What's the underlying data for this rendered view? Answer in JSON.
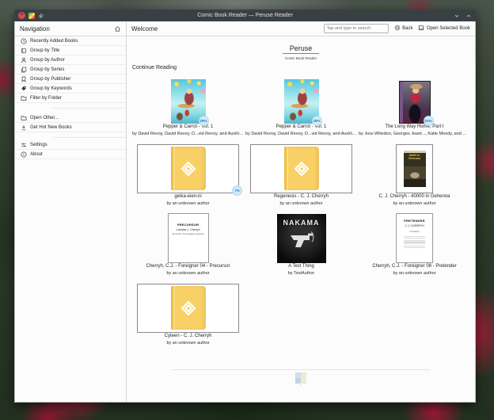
{
  "window": {
    "title": "Comic Book Reader — Peruse Reader"
  },
  "sidebar": {
    "title": "Navigation",
    "items": [
      {
        "label": "Recently Added Books",
        "icon": "clock-icon"
      },
      {
        "label": "Group by Title",
        "icon": "book-icon"
      },
      {
        "label": "Group by Author",
        "icon": "person-icon"
      },
      {
        "label": "Group by Series",
        "icon": "series-icon"
      },
      {
        "label": "Group by Publisher",
        "icon": "pennant-icon"
      },
      {
        "label": "Group by Keywords",
        "icon": "tag-icon"
      },
      {
        "label": "Filter by Folder",
        "icon": "folder-icon"
      }
    ],
    "secondary_items": [
      {
        "label": "Open Other...",
        "icon": "folder-icon"
      },
      {
        "label": "Get Hot New Books",
        "icon": "download-icon"
      }
    ],
    "footer_items": [
      {
        "label": "Settings",
        "icon": "settings-icon"
      },
      {
        "label": "About",
        "icon": "info-icon"
      }
    ]
  },
  "toolbar": {
    "page_title": "Welcome",
    "search_placeholder": "Tap and type to search",
    "back_label": "Back",
    "open_book_label": "Open Selected Book"
  },
  "hero": {
    "app_name": "Peruse",
    "app_subtitle": "Comic Book Reader"
  },
  "section": {
    "title": "Continue Reading"
  },
  "books": [
    {
      "title": "Pepper & Carrot - Vol. 1",
      "author": "by David Revoy, David Revoy, D...vid Revoy, and Aurélien Gâteau",
      "progress": "29%",
      "cover": "pepper"
    },
    {
      "title": "Pepper & Carrot - Vol. 1",
      "author": "by David Revoy, David Revoy, D...vid Revoy, and Aurélien Gâteau",
      "progress": "29%",
      "cover": "pepper"
    },
    {
      "title": "The Long Way Home, Part I",
      "author": "by Joss Whedon, Georges Jeant..., Katie Moody, and Matt Dryer",
      "progress": "51%",
      "cover": "buffy"
    },
    {
      "title": "geika-eien-ni",
      "author": "by an unknown author",
      "progress": "7%",
      "cover": "placeholder-wide"
    },
    {
      "title": "Regenesis - C. J. Cherryh",
      "author": "by an unknown author",
      "progress": "",
      "cover": "placeholder-wide"
    },
    {
      "title": "C. J. Cherryh - 40000 in Gehenna",
      "author": "by an unknown author",
      "progress": "",
      "cover": "gehenna",
      "cover_title": "40000 in Gehenna"
    },
    {
      "title": "Cherryh, C.J. - Foreigner 04 - Precursor",
      "author": "by an unknown author",
      "progress": "",
      "cover": "precursor",
      "cover_lines": [
        "PRECURSOR",
        "Caroline J. Cherryh",
        "the fourth in the Foreigner sequence"
      ]
    },
    {
      "title": "A Test Thing",
      "author": "by TestAuthor",
      "progress": "",
      "cover": "nakama",
      "cover_title": "NAKAMA"
    },
    {
      "title": "Cherryh, C.J. - Foreigner 08 - Pretender",
      "author": "by an unknown author",
      "progress": "",
      "cover": "pretender",
      "cover_lines": [
        "PRETENDER",
        "C.J. CHERRYH"
      ],
      "cover_accent": "Contents"
    },
    {
      "title": "Cyteen - C. J. Cherryh",
      "author": "by an unknown author",
      "progress": "",
      "cover": "placeholder-wide"
    }
  ],
  "colors": {
    "titlebar": "#3a3f44",
    "window_bg": "#fcfcfc",
    "accent": "#3daee9",
    "badge_bg": "#d2eaf8",
    "badge_text": "#1c7fc4",
    "placeholder_book": "#f8d066",
    "close_button": "#d14d52"
  }
}
